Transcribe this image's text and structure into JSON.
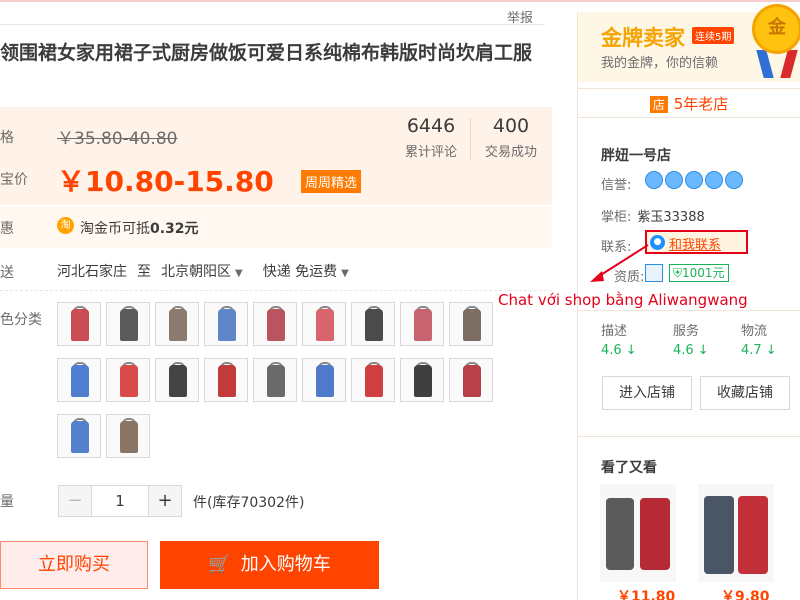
{
  "header": {
    "report_link": "举报"
  },
  "product": {
    "title": "领围裙女家用裙子式厨房做饭可爱日系纯棉布韩版时尚坎肩工服",
    "price_label": "格",
    "original_price": "￥35.80-40.80",
    "promo_label": "宝价",
    "promo_price": "￥10.80-15.80",
    "promo_tag": "周周精选",
    "stats": [
      {
        "value": "6446",
        "caption": "累计评论"
      },
      {
        "value": "400",
        "caption": "交易成功"
      }
    ],
    "discount_label": "惠",
    "coin_icon_text": "淘",
    "coin_text_prefix": "淘金币可抵",
    "coin_amount": "0.32元",
    "ship_label": "送",
    "ship_from": "河北石家庄",
    "ship_to_word": "至",
    "ship_to": "北京朝阳区",
    "ship_method": "快递 免运费",
    "color_label": "色分类",
    "quantity_label": "量",
    "quantity_value": "1",
    "quantity_minus": "−",
    "quantity_plus": "+",
    "stock_text": "件(库存70302件)",
    "buy_now": "立即购买",
    "add_to_cart": "加入购物车"
  },
  "swatch_colors": [
    "#c94c55",
    "#5b5b5b",
    "#8a7a70",
    "#5f86c9",
    "#b95560",
    "#d9646b",
    "#4b4b4b",
    "#c86470",
    "#7d6e63",
    "#4f7fd0",
    "#d94a4a",
    "#444444",
    "#c23a3a",
    "#6a6a6a",
    "#4f79c9",
    "#d04040",
    "#3f3f3f",
    "#b8404a",
    "#5580cc",
    "#8a7565"
  ],
  "seller": {
    "gold_title": "金牌卖家",
    "gold_badge": "连续5期",
    "gold_sub": "我的金牌，你的信赖",
    "medal_char": "金",
    "shop_icon": "店",
    "years": "5年老店",
    "shop_name": "胖妞一号店",
    "credit_label": "信誉:",
    "keeper_label": "掌柜:",
    "keeper_value": "紫玉33388",
    "contact_label": "联系:",
    "contact_button": "和我联系",
    "qual_label": "资质:",
    "deposit": "1001元",
    "scores": [
      {
        "name": "描述",
        "value": "4.6 ↓"
      },
      {
        "name": "服务",
        "value": "4.6 ↓"
      },
      {
        "name": "物流",
        "value": "4.7 ↓"
      }
    ],
    "enter_shop": "进入店铺",
    "favorite_shop": "收藏店铺",
    "also_viewed": "看了又看",
    "rec_prices": [
      "￥11.80",
      "￥9.80"
    ]
  },
  "annotation": "Chat với shop bằng Aliwangwang",
  "colors": {
    "accent": "#ff4400",
    "gold": "#f5a300",
    "annotation": "#e4001b"
  }
}
